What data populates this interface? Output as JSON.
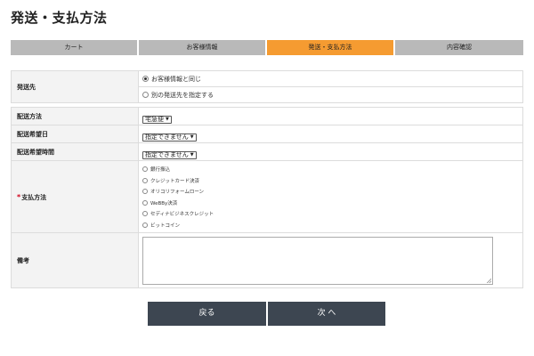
{
  "page": {
    "title": "発送・支払方法"
  },
  "steps": [
    {
      "label": "カート",
      "active": false
    },
    {
      "label": "お客様情報",
      "active": false
    },
    {
      "label": "発送・支払方法",
      "active": true
    },
    {
      "label": "内容確認",
      "active": false
    }
  ],
  "shipping_destination": {
    "label": "発送先",
    "options": [
      {
        "label": "お客様情報と同じ",
        "checked": true
      },
      {
        "label": "別の発送先を指定する",
        "checked": false
      }
    ]
  },
  "delivery": {
    "method_label": "配送方法",
    "method_value": "宅急便",
    "date_label": "配送希望日",
    "date_value": "指定できません",
    "time_label": "配送希望時間",
    "time_value": "指定できません"
  },
  "payment": {
    "required_mark": "*",
    "label": "支払方法",
    "options": [
      {
        "label": "銀行振込"
      },
      {
        "label": "クレジットカード決済"
      },
      {
        "label": "オリコリフォームローン"
      },
      {
        "label": "WeBBy決済"
      },
      {
        "label": "セディナビジネスクレジット"
      },
      {
        "label": "ビットコイン"
      }
    ]
  },
  "notes": {
    "label": "備考",
    "value": ""
  },
  "buttons": {
    "back": "戻る",
    "next": "次 へ"
  },
  "colors": {
    "active_step": "#f59b31",
    "inactive_step": "#b9b9b9",
    "button": "#3d4651",
    "required": "#d0021b"
  }
}
